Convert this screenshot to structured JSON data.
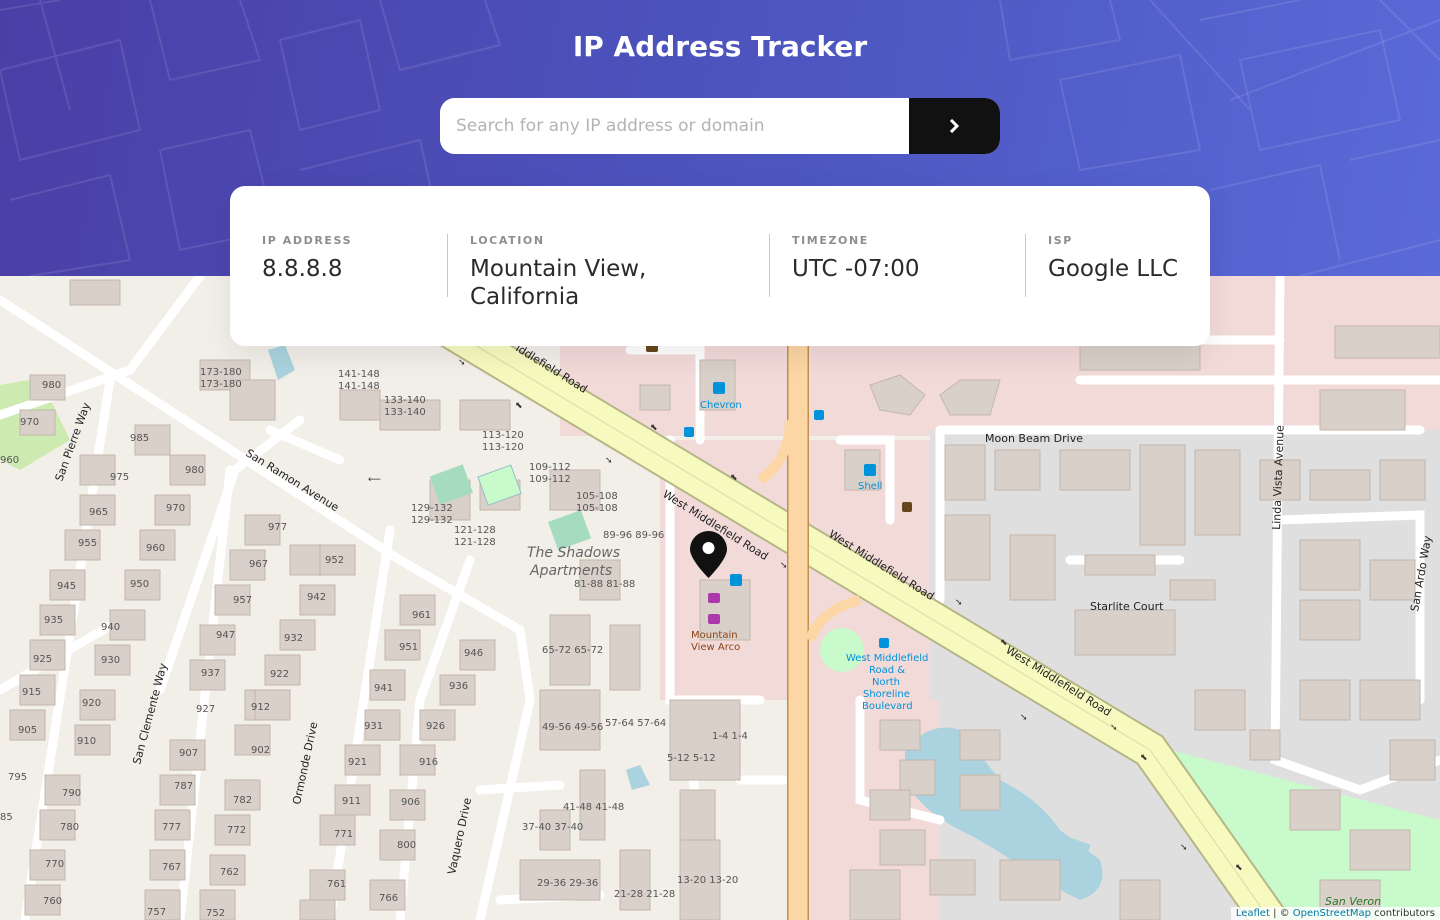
{
  "app": {
    "title": "IP Address Tracker"
  },
  "search": {
    "placeholder": "Search for any IP address or domain",
    "value": "",
    "button_icon": "chevron-right-icon"
  },
  "info": {
    "ip": {
      "label": "IP ADDRESS",
      "value": "8.8.8.8"
    },
    "location": {
      "label": "LOCATION",
      "value_line1": "Mountain View,",
      "value_line2": "California"
    },
    "timezone": {
      "label": "TIMEZONE",
      "value": "UTC -07:00"
    },
    "isp": {
      "label": "ISP",
      "value": "Google LLC"
    }
  },
  "map": {
    "marker_icon": "location-pin-icon",
    "streets": {
      "west_middlefield_1": "West Middlefield Road",
      "west_middlefield_2": "West Middlefield Road",
      "west_middlefield_3": "West Middlefield Road",
      "middlefield_top": "iddlefield Road",
      "san_ramon": "San Ramon Avenue",
      "san_pierre": "San Pierre Way",
      "san_clemente": "San Clemente Way",
      "ormonde": "Ormonde Drive",
      "vaquero": "Vaquero Drive",
      "moon_beam": "Moon Beam Drive",
      "linda_vista": "Linda Vista Avenue",
      "san_ardo": "San Ardo Way",
      "starlite": "Starlite Court",
      "san_veron": "San Veron"
    },
    "places": {
      "chevron": "Chevron",
      "shell": "Shell",
      "shadows_1": "The Shadows",
      "shadows_2": "Apartments",
      "arco_1": "Mountain",
      "arco_2": "View Arco",
      "bus_stop_1": "West Middlefield",
      "bus_stop_2": "Road &",
      "bus_stop_3": "North",
      "bus_stop_4": "Shoreline",
      "bus_stop_5": "Boulevard"
    },
    "attribution": {
      "leaflet": "Leaflet",
      "sep": " | © ",
      "osm": "OpenStreetMap",
      "contributors": " contributors"
    }
  }
}
